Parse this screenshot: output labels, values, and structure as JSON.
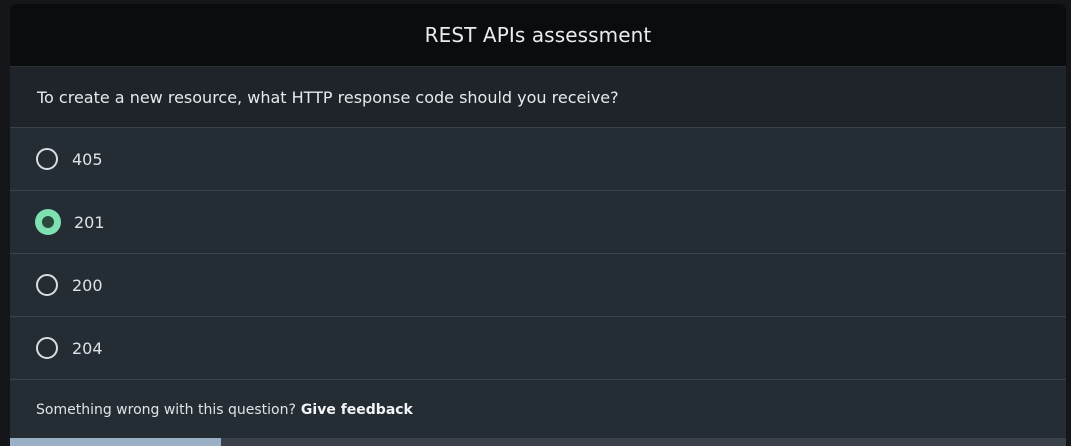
{
  "header": {
    "title": "REST APIs assessment"
  },
  "question": {
    "text": "To create a new resource, what HTTP response code should you receive?"
  },
  "options": [
    {
      "label": "405",
      "selected": false
    },
    {
      "label": "201",
      "selected": true
    },
    {
      "label": "200",
      "selected": false
    },
    {
      "label": "204",
      "selected": false
    }
  ],
  "footer": {
    "prompt": "Something wrong with this question?",
    "link": "Give feedback"
  },
  "progress": {
    "fraction": 0.2
  },
  "colors": {
    "accent": "#7fe0b2",
    "progress": "#9bb0c4",
    "header_bg": "#0b0c0e",
    "card_bg": "#252d34"
  }
}
